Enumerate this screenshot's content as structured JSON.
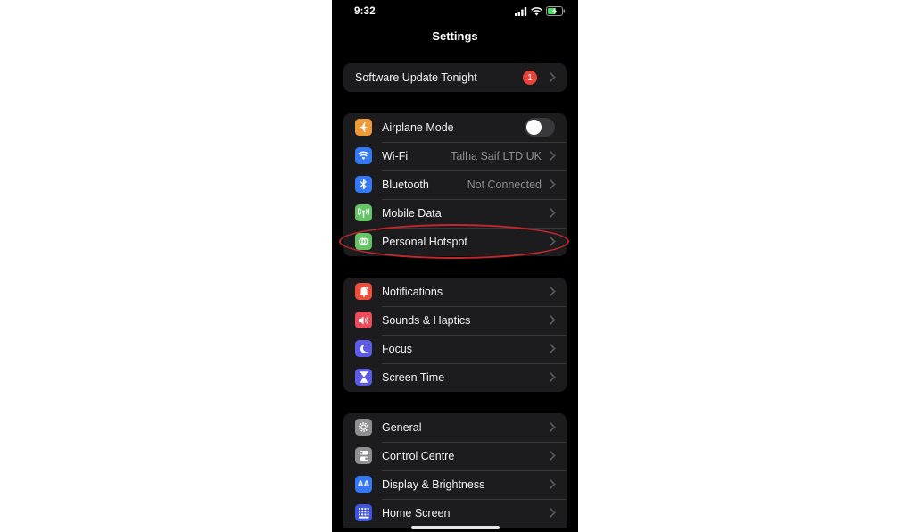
{
  "status_bar": {
    "time": "9:32"
  },
  "nav": {
    "title": "Settings"
  },
  "update_row": {
    "label": "Software Update Tonight",
    "badge": "1"
  },
  "group1": [
    {
      "label": "Airplane Mode",
      "icon": "airplane-icon",
      "color": "#f09a37",
      "toggle": false
    },
    {
      "label": "Wi-Fi",
      "value": "Talha Saif LTD UK",
      "icon": "wifi-icon",
      "color": "#3478f6"
    },
    {
      "label": "Bluetooth",
      "value": "Not Connected",
      "icon": "bluetooth-icon",
      "color": "#3478f6"
    },
    {
      "label": "Mobile Data",
      "icon": "antenna-icon",
      "color": "#65c466"
    },
    {
      "label": "Personal Hotspot",
      "icon": "hotspot-icon",
      "color": "#65c466"
    }
  ],
  "group2": [
    {
      "label": "Notifications",
      "icon": "bell-icon",
      "color": "#eb4e3d"
    },
    {
      "label": "Sounds & Haptics",
      "icon": "speaker-icon",
      "color": "#eb4e5a"
    },
    {
      "label": "Focus",
      "icon": "moon-icon",
      "color": "#5e5ce6"
    },
    {
      "label": "Screen Time",
      "icon": "hourglass-icon",
      "color": "#5e5ce6"
    }
  ],
  "group3": [
    {
      "label": "General",
      "icon": "gear-icon",
      "color": "#8e8e93"
    },
    {
      "label": "Control Centre",
      "icon": "switches-icon",
      "color": "#8e8e93"
    },
    {
      "label": "Display & Brightness",
      "icon": "text-size-icon",
      "color": "#3478f6",
      "glyph": "AA"
    },
    {
      "label": "Home Screen",
      "icon": "home-grid-icon",
      "color": "#3d55e0"
    }
  ]
}
